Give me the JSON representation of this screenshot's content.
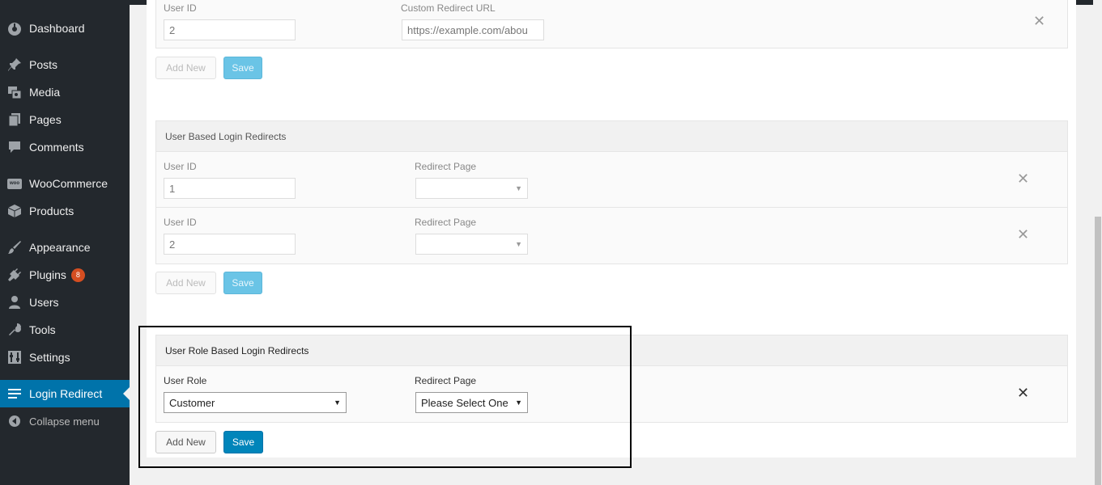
{
  "sidebar": {
    "dashboard": "Dashboard",
    "posts": "Posts",
    "media": "Media",
    "pages": "Pages",
    "comments": "Comments",
    "woocommerce": "WooCommerce",
    "woo_icon_text": "woo",
    "products": "Products",
    "appearance": "Appearance",
    "plugins": "Plugins",
    "plugins_badge": "8",
    "users": "Users",
    "tools": "Tools",
    "settings": "Settings",
    "login_redirect": "Login Redirect",
    "collapse": "Collapse menu"
  },
  "top_section": {
    "user_id_label": "User ID",
    "url_label": "Custom Redirect URL",
    "user_id_value": "2",
    "url_value": "https://example.com/abou",
    "add_new": "Add New",
    "save": "Save",
    "remove": "✕"
  },
  "user_section": {
    "title": "User Based Login Redirects",
    "rows": [
      {
        "user_id_label": "User ID",
        "user_id": "1",
        "page_label": "Redirect Page",
        "page_value": ""
      },
      {
        "user_id_label": "User ID",
        "user_id": "2",
        "page_label": "Redirect Page",
        "page_value": ""
      }
    ],
    "add_new": "Add New",
    "save": "Save",
    "remove": "✕"
  },
  "role_section": {
    "title": "User Role Based Login Redirects",
    "role_label": "User Role",
    "role_value": "Customer",
    "page_label": "Redirect Page",
    "page_value": "Please Select One",
    "add_new": "Add New",
    "save": "Save",
    "remove": "✕"
  },
  "colors": {
    "sidebar_bg": "#23282d",
    "active_menu": "#0073aa",
    "primary_button": "#0085ba",
    "badge": "#d54e21"
  }
}
